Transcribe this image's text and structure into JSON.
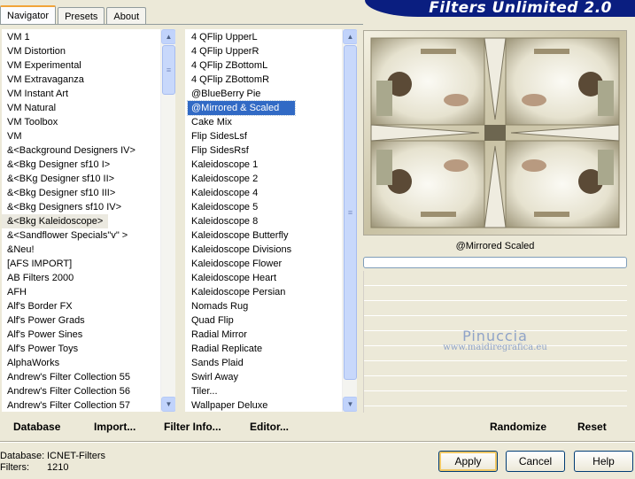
{
  "tabs": [
    {
      "label": "Navigator",
      "active": true
    },
    {
      "label": "Presets",
      "active": false
    },
    {
      "label": "About",
      "active": false
    }
  ],
  "app_title": "Filters Unlimited 2.0",
  "categories": [
    "VM 1",
    "VM Distortion",
    "VM Experimental",
    "VM Extravaganza",
    "VM Instant Art",
    "VM Natural",
    "VM Toolbox",
    "VM",
    "&<Background Designers IV>",
    "&<Bkg Designer sf10 I>",
    "&<BKg Designer sf10 II>",
    "&<Bkg Designer sf10 III>",
    "&<Bkg Designers sf10 IV>",
    "&<Bkg Kaleidoscope>",
    "&<Sandflower Specials\"v\" >",
    "&Neu!",
    "[AFS IMPORT]",
    "AB Filters 2000",
    "AFH",
    "Alf's Border FX",
    "Alf's Power Grads",
    "Alf's Power Sines",
    "Alf's Power Toys",
    "AlphaWorks",
    "Andrew's Filter Collection 55",
    "Andrew's Filter Collection 56",
    "Andrew's Filter Collection 57"
  ],
  "selected_category_index": 13,
  "filters": [
    "4 QFlip UpperL",
    "4 QFlip UpperR",
    "4 QFlip ZBottomL",
    "4 QFlip ZBottomR",
    "@BlueBerry Pie",
    "@Mirrored & Scaled",
    "Cake Mix",
    "Flip SidesLsf",
    "Flip SidesRsf",
    "Kaleidoscope 1",
    "Kaleidoscope 2",
    "Kaleidoscope 4",
    "Kaleidoscope 5",
    "Kaleidoscope 8",
    "Kaleidoscope Butterfly",
    "Kaleidoscope Divisions",
    "Kaleidoscope Flower",
    "Kaleidoscope Heart",
    "Kaleidoscope Persian",
    "Nomads Rug",
    "Quad Flip",
    "Radial Mirror",
    "Radial Replicate",
    "Sands Plaid",
    "Swirl Away",
    "Tiler...",
    "Wallpaper Deluxe"
  ],
  "selected_filter_index": 5,
  "current_filter_display": "@Mirrored  Scaled",
  "watermark": {
    "title": "Pinuccia",
    "url": "www.maidiregrafica.eu"
  },
  "menu": {
    "database": "Database",
    "import": "Import...",
    "filter_info": "Filter Info...",
    "editor": "Editor...",
    "randomize": "Randomize",
    "reset": "Reset"
  },
  "info": {
    "database_label": "Database:",
    "database_value": "ICNET-Filters",
    "filters_label": "Filters:",
    "filters_value": "1210"
  },
  "buttons": {
    "apply": "Apply",
    "cancel": "Cancel",
    "help": "Help"
  },
  "icons": {
    "scroll_up": "chevron-up-icon",
    "scroll_down": "chevron-down-icon",
    "thumb_grip": "grip-icon"
  },
  "colors": {
    "banner": "#0a1e80",
    "selection": "#316ac5",
    "active_tab": "#f1a43a"
  }
}
